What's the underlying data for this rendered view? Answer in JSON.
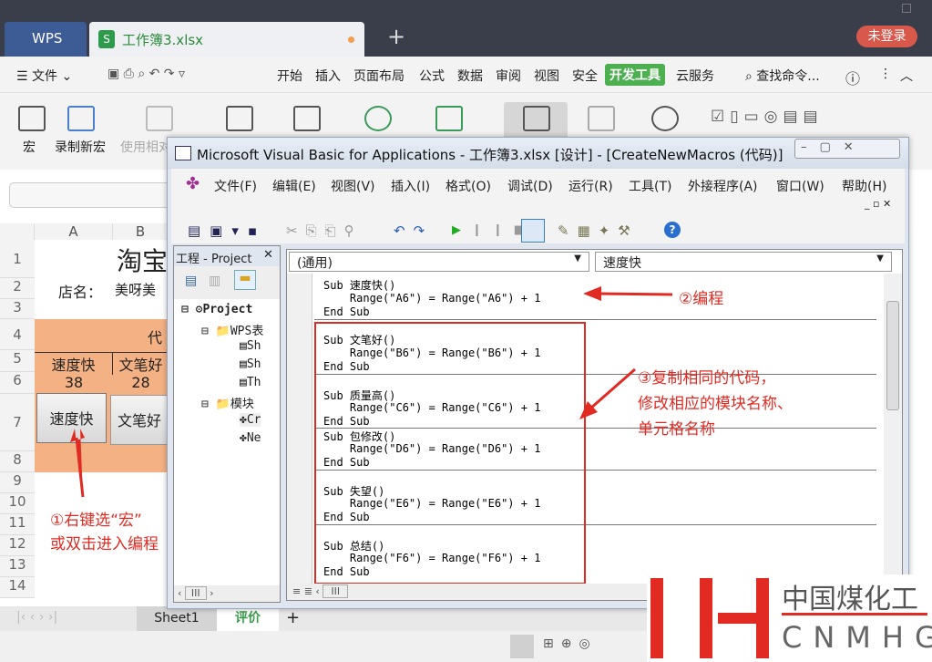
{
  "app": {
    "wps_tab": "WPS",
    "doc_tab": "工作簿3.xlsx",
    "doc_icon": "S",
    "login": "未登录",
    "new_tab": "+"
  },
  "menu": {
    "file": "文件",
    "items": [
      "开始",
      "插入",
      "页面布局",
      "公式",
      "数据",
      "审阅",
      "视图",
      "安全",
      "开发工具",
      "云服务"
    ],
    "active": "开发工具",
    "search": "查找命令..."
  },
  "ribbon": {
    "macro": "宏",
    "record": "录制新宏",
    "relative": "使用相对引用"
  },
  "sheet": {
    "cols": [
      "A",
      "B"
    ],
    "rows": [
      "1",
      "2",
      "3",
      "4",
      "5",
      "6",
      "7",
      "8",
      "9",
      "10",
      "11",
      "12",
      "13",
      "14"
    ],
    "title": "淘宝",
    "shop_label": "店名：",
    "shop_value": "美呀美",
    "header_partial": "代",
    "c_a5": "速度快",
    "c_b5": "文笔好",
    "c_a6": "38",
    "c_b6": "28",
    "btn_a7": "速度快",
    "btn_b7": "文笔好",
    "tabs": [
      "Sheet1",
      "评价"
    ],
    "active_tab": "评价"
  },
  "vba": {
    "title": "Microsoft Visual Basic for Applications - 工作簿3.xlsx [设计] - [CreateNewMacros (代码)]",
    "menu": [
      "文件(F)",
      "编辑(E)",
      "视图(V)",
      "插入(I)",
      "格式(O)",
      "调试(D)",
      "运行(R)",
      "工具(T)",
      "外接程序(A)",
      "窗口(W)",
      "帮助(H)"
    ],
    "project_title": "工程 - Project",
    "tree": [
      "Project",
      "WPS表",
      "Sh",
      "Sh",
      "Th",
      "模块",
      "Cr",
      "Ne"
    ],
    "object_dropdown": "(通用)",
    "proc_dropdown": "速度快",
    "subs": [
      {
        "name": "Sub 速度快()",
        "body": "    Range(\"A6\") = Range(\"A6\") + 1",
        "end": "End Sub"
      },
      {
        "name": "Sub 文笔好()",
        "body": "    Range(\"B6\") = Range(\"B6\") + 1",
        "end": "End Sub"
      },
      {
        "name": "Sub 质量高()",
        "body": "    Range(\"C6\") = Range(\"C6\") + 1",
        "end": "End Sub"
      },
      {
        "name": "Sub 包修改()",
        "body": "    Range(\"D6\") = Range(\"D6\") + 1",
        "end": "End Sub"
      },
      {
        "name": "Sub 失望()",
        "body": "    Range(\"E6\") = Range(\"E6\") + 1",
        "end": "End Sub"
      },
      {
        "name": "Sub 总结()",
        "body": "    Range(\"F6\") = Range(\"F6\") + 1",
        "end": "End Sub"
      }
    ]
  },
  "annotations": {
    "a1_line1": "①右键选“宏”",
    "a1_line2": "或双击进入编程",
    "a2": "②编程",
    "a3_line1": "③复制相同的代码，",
    "a3_line2": "修改相应的模块名称、",
    "a3_line3": "单元格名称"
  },
  "watermark": {
    "cn": "中国煤化工",
    "en": "CNMHG"
  },
  "colors": {
    "accent": "#4caf50",
    "annotation": "#e02a22",
    "header_fill": "#f4b183"
  }
}
